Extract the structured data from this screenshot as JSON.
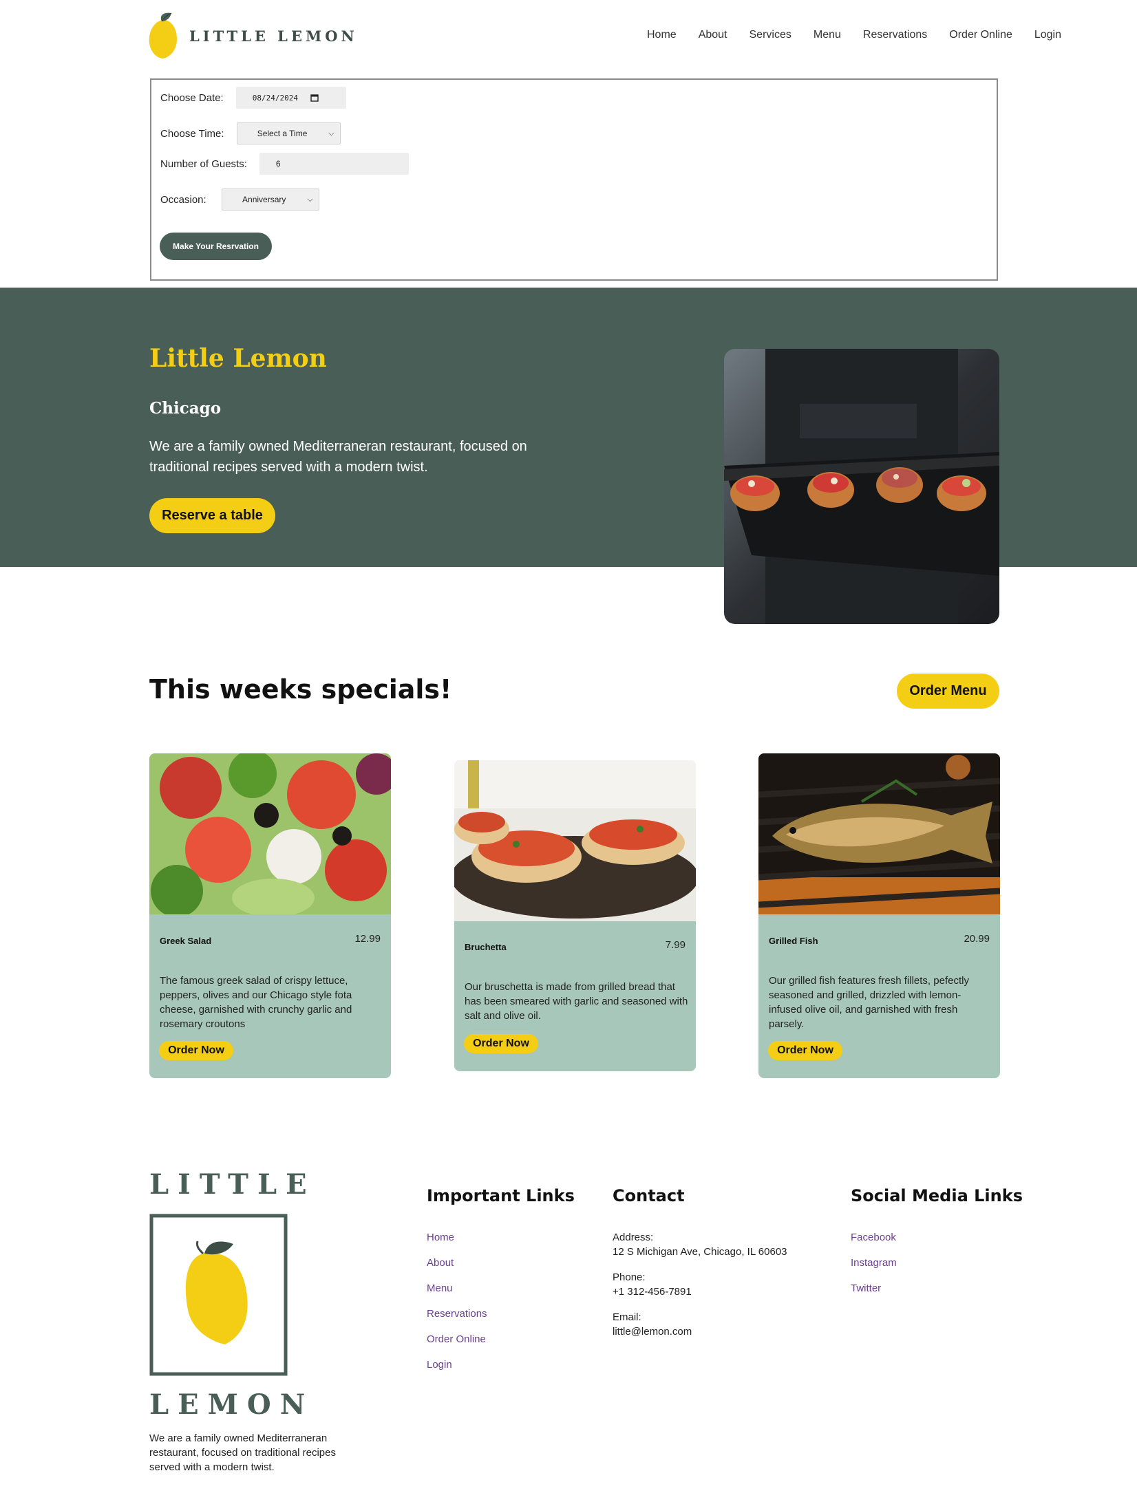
{
  "brand": {
    "name": "LITTLE LEMON",
    "colors": {
      "primary": "#495e57",
      "accent": "#f4ce14",
      "card": "#a8c7bb"
    }
  },
  "nav": {
    "items": [
      "Home",
      "About",
      "Services",
      "Menu",
      "Reservations",
      "Order Online",
      "Login"
    ]
  },
  "form": {
    "date_label": "Choose Date:",
    "date_value": "08/24/2024",
    "time_label": "Choose Time:",
    "time_value": "Select a Time",
    "guests_label": "Number of Guests:",
    "guests_value": "6",
    "occasion_label": "Occasion:",
    "occasion_value": "Anniversary",
    "submit_label": "Make Your Resrvation"
  },
  "hero": {
    "title": "Little Lemon",
    "subtitle": "Chicago",
    "description": "We are a family owned Mediterraneran restaurant, focused on traditional recipes served with a modern twist.",
    "button": "Reserve a table"
  },
  "specials": {
    "title": "This weeks specials!",
    "order_menu": "Order Menu",
    "cards": [
      {
        "name": "Greek Salad",
        "price": "12.99",
        "description": "The famous greek salad of crispy lettuce, peppers, olives and our Chicago style fota cheese, garnished with crunchy garlic and rosemary croutons",
        "button": "Order Now"
      },
      {
        "name": "Bruchetta",
        "price": "7.99",
        "description": "Our bruschetta is made from grilled bread that has been smeared with garlic and seasoned with salt and olive oil.",
        "button": "Order Now"
      },
      {
        "name": "Grilled Fish",
        "price": "20.99",
        "description": "Our grilled fish features fresh fillets, pefectly seasoned and grilled, drizzled with lemon-infused olive oil, and garnished with fresh parsely.",
        "button": "Order Now"
      }
    ]
  },
  "footer": {
    "logo_top": "LITTLE",
    "logo_bottom": "LEMON",
    "description": "We are a family owned Mediterraneran restaurant, focused on traditional recipes served with a modern twist.",
    "links_title": "Important Links",
    "links": [
      "Home",
      "About",
      "Menu",
      "Reservations",
      "Order Online",
      "Login"
    ],
    "contact_title": "Contact",
    "address_label": "Address:",
    "address": "12 S Michigan Ave, Chicago, IL 60603",
    "phone_label": "Phone:",
    "phone": "+1 312-456-7891",
    "email_label": "Email:",
    "email": "little@lemon.com",
    "social_title": "Social Media Links",
    "social": [
      "Facebook",
      "Instagram",
      "Twitter"
    ]
  }
}
